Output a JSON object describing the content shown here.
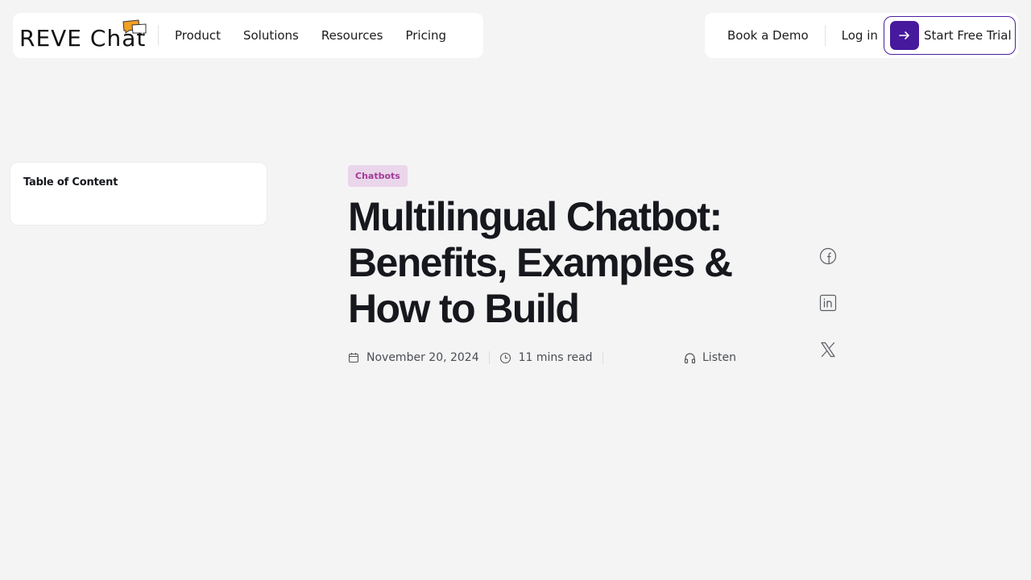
{
  "header": {
    "logo_text": "REVE Chat",
    "nav_items": [
      "Product",
      "Solutions",
      "Resources",
      "Pricing"
    ],
    "book_demo": "Book a Demo",
    "login": "Log in",
    "trial": "Start Free Trial"
  },
  "toc": {
    "title": "Table of Content"
  },
  "article": {
    "category": "Chatbots",
    "title": "Multilingual Chatbot: Benefits, Examples & How to Build",
    "date": "November 20, 2024",
    "read_time": "11 mins read",
    "listen": "Listen"
  },
  "share": {
    "icons": [
      "facebook-icon",
      "linkedin-icon",
      "x-icon"
    ]
  },
  "colors": {
    "accent": "#46199d",
    "tag_bg": "#ead6ea",
    "tag_text": "#a23b98",
    "page_bg": "#f4f4f4"
  }
}
